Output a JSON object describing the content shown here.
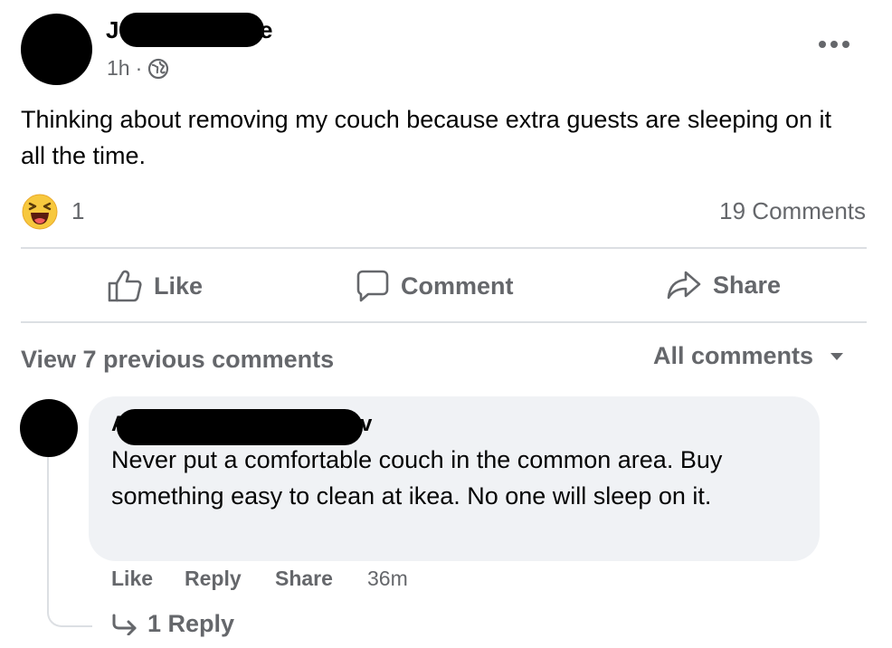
{
  "post": {
    "author_initial": "J",
    "author_final": "e",
    "time": "1h",
    "separator": "·",
    "text": "Thinking about removing my couch because extra guests are sleeping on it all the time.",
    "reaction_count": "1",
    "comments_count": "19 Comments"
  },
  "actions": {
    "like": "Like",
    "comment": "Comment",
    "share": "Share"
  },
  "comments_section": {
    "view_previous": "View 7 previous comments",
    "filter": "All comments"
  },
  "comment": {
    "author_initial": "A",
    "author_final": "v",
    "text": "Never put a comfortable couch in the common area. Buy something easy to clean at ikea. No one will sleep on it.",
    "like": "Like",
    "reply": "Reply",
    "share": "Share",
    "time": "36m",
    "replies": "1 Reply"
  },
  "colors": {
    "text": "#050505",
    "secondary": "#65676b",
    "bubble": "#f0f2f5",
    "divider": "#dcdfe3"
  }
}
